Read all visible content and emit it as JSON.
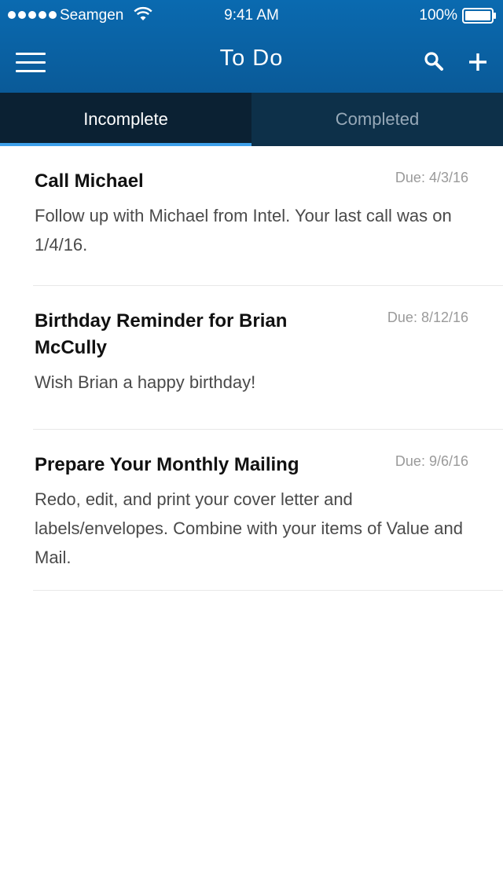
{
  "status_bar": {
    "carrier": "Seamgen",
    "time": "9:41 AM",
    "battery": "100%"
  },
  "nav": {
    "title": "To Do",
    "icons": [
      "hamburger-menu-icon",
      "search-icon",
      "plus-icon"
    ]
  },
  "tabs": [
    {
      "label": "Incomplete",
      "active": true
    },
    {
      "label": "Completed",
      "active": false
    }
  ],
  "tasks": [
    {
      "title": "Call Michael",
      "due": "Due: 4/3/16",
      "description": "Follow up with Michael from Intel. Your last call was on 1/4/16."
    },
    {
      "title": "Birthday Reminder for Brian McCully",
      "due": "Due: 8/12/16",
      "description": "Wish Brian a happy birthday!"
    },
    {
      "title": "Prepare Your Monthly Mailing",
      "due": "Due: 9/6/16",
      "description": "Redo, edit, and print your cover letter and labels/envelopes. Combine with your items of Value and Mail."
    }
  ],
  "colors": {
    "header": "#0a6ab0",
    "tab_active_bg": "#0b2133",
    "tab_inactive_bg": "#0d3049",
    "tab_indicator": "#3ea0ea"
  }
}
